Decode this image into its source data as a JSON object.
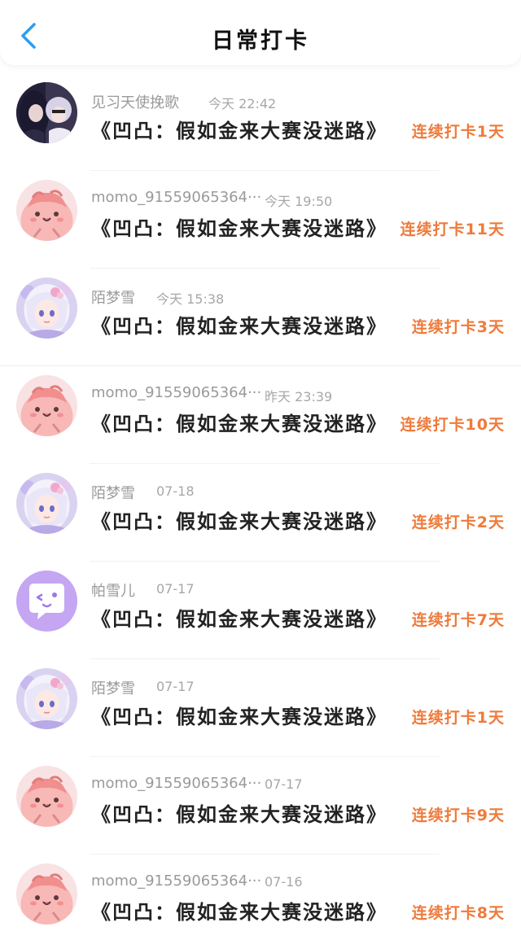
{
  "header": {
    "title": "日常打卡",
    "back_icon": "chevron-left-icon",
    "accent_color": "#2b9cf2"
  },
  "checkins": [
    {
      "name": "见习天使挽歌",
      "time": "今天 22:42",
      "title": "《凹凸：假如金来大赛没迷路》",
      "streak": "连续打卡1天",
      "avatar": "dark-anime-pair"
    },
    {
      "name": "momo_91559065364···",
      "time": "今天 19:50",
      "title": "《凹凸：假如金来大赛没迷路》",
      "streak": "连续打卡11天",
      "avatar": "pink-blob"
    },
    {
      "name": "陌梦雪",
      "time": "今天 15:38",
      "title": "《凹凸：假如金来大赛没迷路》",
      "streak": "连续打卡3天",
      "avatar": "anime-girl-white-hair"
    },
    {
      "name": "momo_91559065364···",
      "time": "昨天 23:39",
      "title": "《凹凸：假如金来大赛没迷路》",
      "streak": "连续打卡10天",
      "avatar": "pink-blob"
    },
    {
      "name": "陌梦雪",
      "time": "07-18",
      "title": "《凹凸：假如金来大赛没迷路》",
      "streak": "连续打卡2天",
      "avatar": "anime-girl-white-hair"
    },
    {
      "name": "帕雪儿",
      "time": "07-17",
      "title": "《凹凸：假如金来大赛没迷路》",
      "streak": "连续打卡7天",
      "avatar": "purple-chat-bubble"
    },
    {
      "name": "陌梦雪",
      "time": "07-17",
      "title": "《凹凸：假如金来大赛没迷路》",
      "streak": "连续打卡1天",
      "avatar": "anime-girl-white-hair"
    },
    {
      "name": "momo_91559065364···",
      "time": "07-17",
      "title": "《凹凸：假如金来大赛没迷路》",
      "streak": "连续打卡9天",
      "avatar": "pink-blob"
    },
    {
      "name": "momo_91559065364···",
      "time": "07-16",
      "title": "《凹凸：假如金来大赛没迷路》",
      "streak": "连续打卡8天",
      "avatar": "pink-blob"
    }
  ],
  "colors": {
    "streak": "#ef7a3a",
    "name": "#9a9a9a",
    "title": "#222222"
  }
}
